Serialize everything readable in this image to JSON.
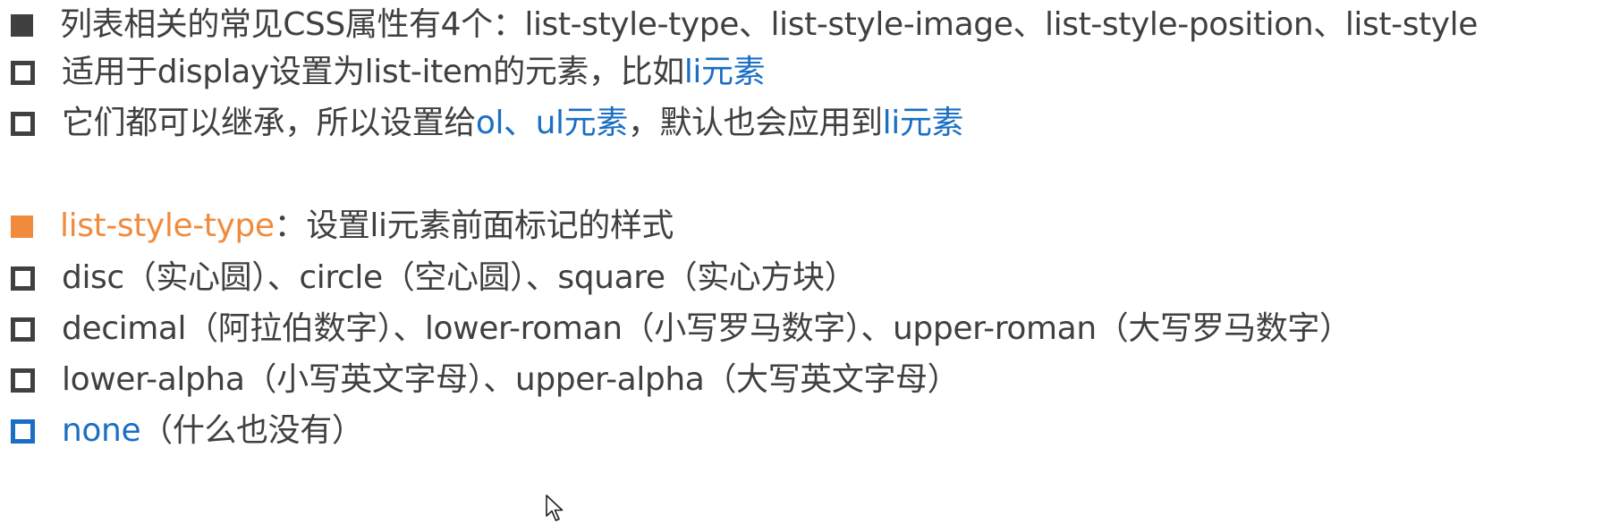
{
  "section1": {
    "line1": {
      "text": "列表相关的常见CSS属性有4个：list-style-type、list-style-image、list-style-position、list-style"
    },
    "line2": {
      "text_a": "适用于display设置为list-item的元素，比如",
      "text_b": "li元素"
    },
    "line3": {
      "text_a": "它们都可以继承，所以设置给",
      "text_b": "ol、ul元素",
      "text_c": "，默认也会应用到",
      "text_d": "li元素"
    }
  },
  "section2": {
    "heading": {
      "property": "list-style-type",
      "description": "：设置li元素前面标记的样式"
    },
    "item1": {
      "text": "disc（实心圆）、circle（空心圆）、square（实心方块）"
    },
    "item2": {
      "text": "decimal（阿拉伯数字）、lower-roman（小写罗马数字）、upper-roman（大写罗马数字）"
    },
    "item3": {
      "text": "lower-alpha（小写英文字母）、upper-alpha（大写英文字母）"
    },
    "item4": {
      "text_a": "none",
      "text_b": "（什么也没有）"
    }
  },
  "icons": {
    "filled_bullet": "filled-square-bullet-icon",
    "hollow_bullet": "hollow-square-bullet-icon",
    "cursor": "mouse-pointer-icon"
  },
  "colors": {
    "text": "#404040",
    "accent_blue": "#1a6fc4",
    "accent_orange": "#f08a3c"
  }
}
